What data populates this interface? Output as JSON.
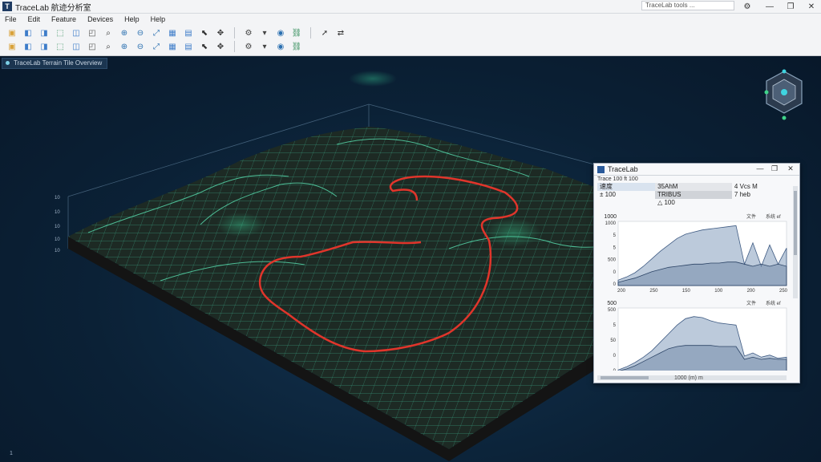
{
  "app": {
    "title": "TraceLab 航迹分析室",
    "logo_letter": "T",
    "search_placeholder": "TraceLab tools ..."
  },
  "window_controls": {
    "min": "—",
    "max": "❐",
    "close": "✕",
    "settings": "⚙"
  },
  "menu": [
    "File",
    "Edit",
    "Feature",
    "Devices",
    "Help",
    "Help"
  ],
  "toolbar": {
    "row1": [
      "folder-icon",
      "open-icon",
      "layer-icon",
      "export-icon",
      "copy-icon",
      "frame-icon",
      "search-icon",
      "zoom-in-icon",
      "zoom-out-icon",
      "zoom-fit-icon",
      "grid-icon",
      "table-icon",
      "select-icon",
      "move-icon",
      "settings-icon",
      "dropdown-icon",
      "node-icon",
      "link-icon",
      "pointer-icon",
      "arrows-icon"
    ],
    "row2": [
      "save-icon",
      "image-icon",
      "layers-icon",
      "chart-icon",
      "edit-icon",
      "crop-icon",
      "cursor-icon",
      "pan-icon",
      "rotate-icon",
      "measure-icon",
      "ruler-icon",
      "mesh-icon",
      "paint-icon",
      "filter-icon",
      "sync-icon",
      "line-icon",
      "box-icon",
      "cube-icon"
    ]
  },
  "viewport": {
    "tab_label": "TraceLab Terrain Tile Overview",
    "axis_ticks": [
      "10",
      "10",
      "10",
      "10",
      "10"
    ],
    "frame_label": "1",
    "colors": {
      "mesh": "#4fd6a6",
      "path": "#e0352b"
    }
  },
  "panel": {
    "title": "TraceLab",
    "subtitle": "Trace 100 ft 100",
    "grid": [
      [
        "速度",
        "35AhM",
        "4 Vcs M"
      ],
      [
        "± 100",
        "TRIBUS",
        "7 heb"
      ],
      [
        "",
        "△ 100",
        ""
      ]
    ],
    "chart1": {
      "ylabel": "1000",
      "yticks": [
        "1000",
        "5",
        "5",
        "500",
        "0",
        "0"
      ],
      "xticks": [
        "200",
        "250",
        "150",
        "100",
        "200",
        "250"
      ],
      "legend": [
        "文件",
        "系统 ef"
      ]
    },
    "chart2": {
      "ylabel": "500",
      "yticks": [
        "500",
        "5",
        "50",
        "0",
        "0"
      ],
      "xticks": [
        "250",
        "200",
        "100",
        "100",
        "350",
        "250"
      ],
      "legend": [
        "文件",
        "系统 ef"
      ]
    },
    "status": "1000 (m)",
    "status2": "m"
  },
  "chart_data": [
    {
      "type": "area",
      "x": [
        0,
        1,
        2,
        3,
        4,
        5,
        6,
        7,
        8,
        9,
        10,
        11,
        12,
        13,
        14,
        15,
        16,
        17,
        18,
        19,
        20
      ],
      "series": [
        {
          "values": [
            5,
            8,
            12,
            18,
            25,
            32,
            38,
            44,
            48,
            50,
            52,
            53,
            54,
            55,
            56,
            20,
            40,
            18,
            38,
            20,
            35
          ]
        },
        {
          "values": [
            3,
            5,
            7,
            10,
            13,
            15,
            17,
            18,
            19,
            20,
            20,
            21,
            21,
            22,
            22,
            20,
            18,
            20,
            18,
            20,
            18
          ]
        }
      ]
    },
    {
      "type": "area",
      "x": [
        0,
        1,
        2,
        3,
        4,
        5,
        6,
        7,
        8,
        9,
        10,
        11,
        12,
        13,
        14,
        15,
        16,
        17,
        18,
        19,
        20
      ],
      "series": [
        {
          "values": [
            2,
            5,
            9,
            14,
            20,
            28,
            36,
            44,
            50,
            52,
            51,
            48,
            46,
            45,
            44,
            15,
            18,
            14,
            16,
            13,
            14
          ]
        },
        {
          "values": [
            1,
            3,
            6,
            10,
            14,
            18,
            22,
            24,
            25,
            25,
            25,
            25,
            24,
            24,
            24,
            12,
            14,
            12,
            13,
            12,
            12
          ]
        }
      ]
    }
  ]
}
